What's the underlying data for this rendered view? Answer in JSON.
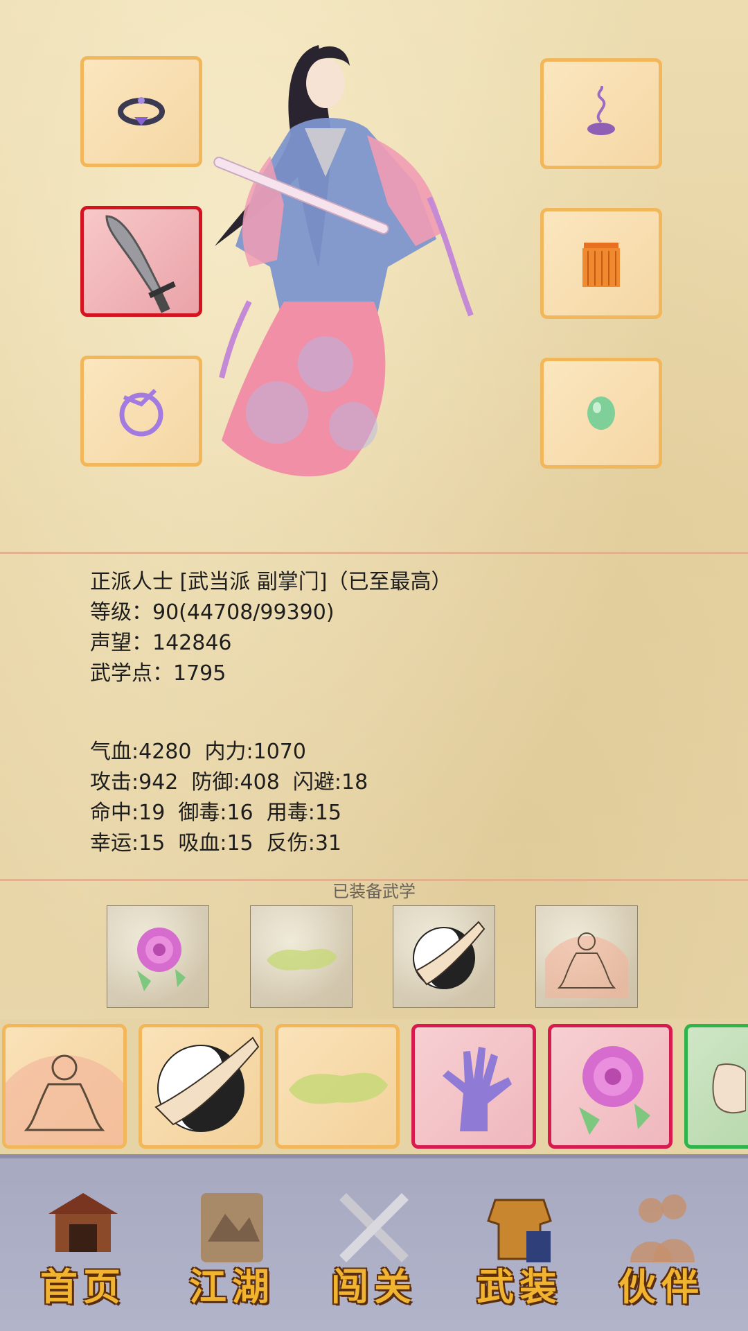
{
  "character": {
    "title_line": "正派人士 [武当派 副掌门]（已至最高）",
    "level_line": "等级：90(44708/99390)",
    "reputation_line": "声望：142846",
    "martial_points_line": "武学点：1795"
  },
  "stats": [
    "气血:4280  内力:1070",
    "攻击:942  防御:408  闪避:18",
    "命中:19  御毒:16  用毒:15",
    "幸运:15  吸血:15  反伤:31"
  ],
  "equipment_slots": {
    "left": [
      {
        "icon": "ring-crown-icon"
      },
      {
        "icon": "broadsword-icon",
        "highlight": "#d3131f"
      },
      {
        "icon": "bracelet-icon"
      }
    ],
    "right": [
      {
        "icon": "incense-icon"
      },
      {
        "icon": "tassel-icon"
      },
      {
        "icon": "jade-stone-icon"
      }
    ]
  },
  "equipped_skills_title": "已装备武学",
  "equipped_skills": [
    "rose-icon",
    "green-beast-icon",
    "yin-yang-palm-icon",
    "meditation-icon"
  ],
  "skill_cards": [
    {
      "icon": "meditation-icon",
      "border": "#f2b75a"
    },
    {
      "icon": "yin-yang-palm-icon",
      "border": "#f2b75a"
    },
    {
      "icon": "green-beast-icon",
      "border": "#f2b75a"
    },
    {
      "icon": "purple-hand-icon",
      "border": "#d81b4f"
    },
    {
      "icon": "rose-icon",
      "border": "#d81b4f"
    },
    {
      "icon": "fist-icon",
      "border": "#2fb44b"
    }
  ],
  "nav": {
    "home": "首页",
    "jianghu": "江湖",
    "challenge": "闯关",
    "equipment": "武装",
    "partner": "伙伴"
  }
}
